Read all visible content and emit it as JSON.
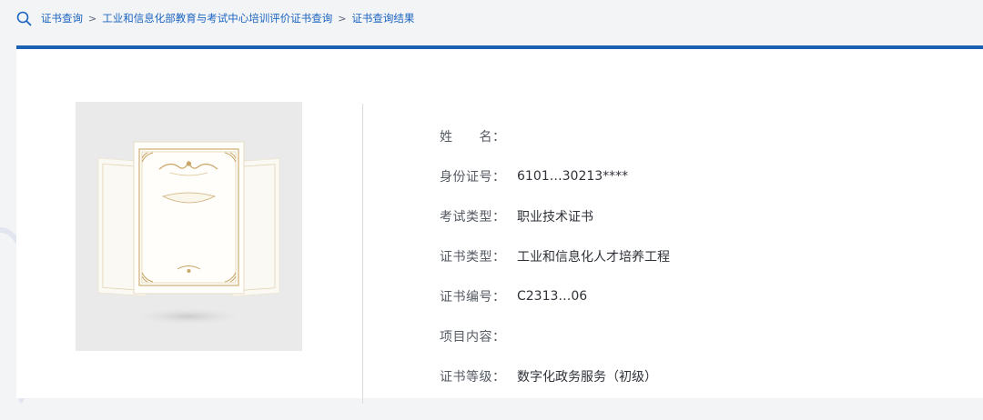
{
  "breadcrumb": {
    "items": [
      "证书查询",
      "工业和信息化部教育与考试中心培训评价证书查询",
      "证书查询结果"
    ],
    "separator": ">"
  },
  "colors": {
    "accent": "#1a61b6",
    "breadcrumb_text": "#1b64c0",
    "label_text": "#555a63",
    "value_text": "#2f3238",
    "page_bg": "#f3f4f6",
    "certificate_bg": "#eaeaea",
    "certificate_ornament": "#c9a566"
  },
  "icons": {
    "search": "search-icon",
    "certificate": "certificate-image"
  },
  "result": {
    "name": {
      "label": "姓　　名：",
      "value": ""
    },
    "id_number": {
      "label": "身份证号：",
      "value": "6101…30213****"
    },
    "exam_type": {
      "label": "考试类型：",
      "value": "职业技术证书"
    },
    "cert_type": {
      "label": "证书类型：",
      "value": "工业和信息化人才培养工程"
    },
    "cert_number": {
      "label": "证书编号：",
      "value": "C2313…06"
    },
    "project_content": {
      "label": "项目内容：",
      "value": ""
    },
    "cert_level": {
      "label": "证书等级：",
      "value": "数字化政务服务（初级）"
    }
  }
}
